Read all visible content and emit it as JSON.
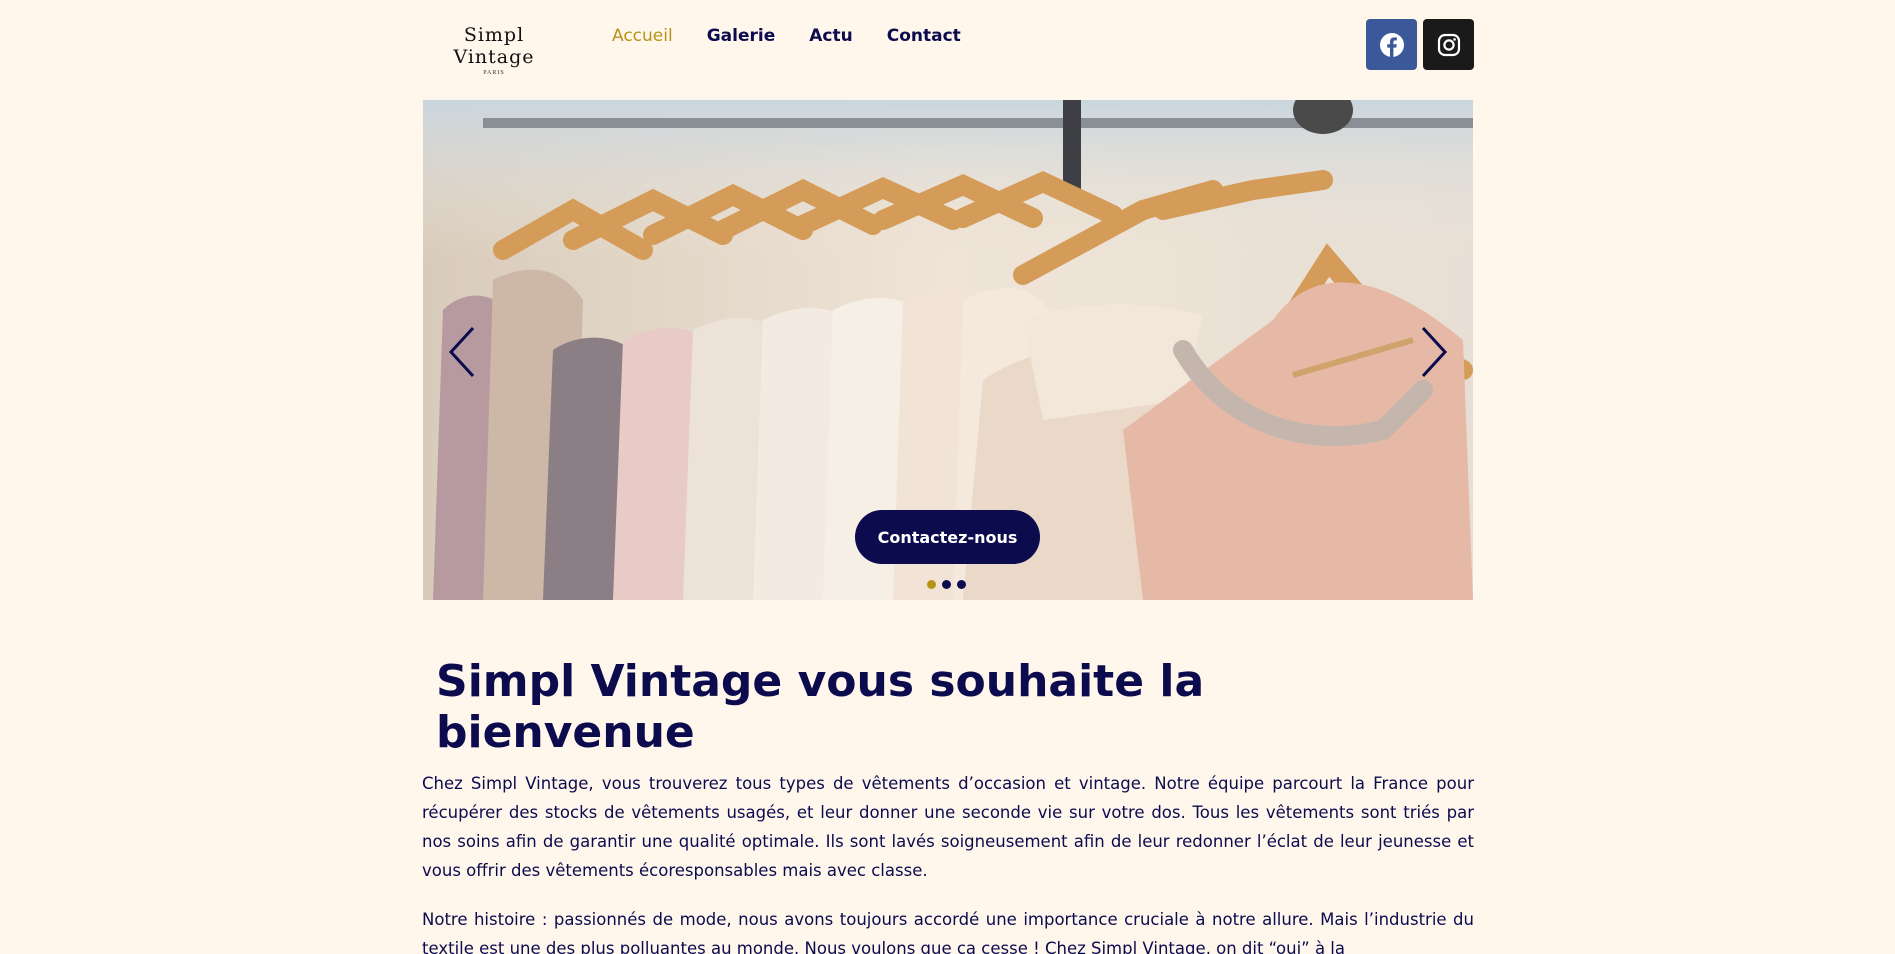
{
  "header": {
    "logo_main": "Simpl Vintage",
    "logo_sub": "PARIS",
    "nav": [
      {
        "label": "Accueil",
        "active": true
      },
      {
        "label": "Galerie",
        "active": false
      },
      {
        "label": "Actu",
        "active": false
      },
      {
        "label": "Contact",
        "active": false
      }
    ],
    "social": [
      {
        "icon": "facebook-icon",
        "color": "#3b5998"
      },
      {
        "icon": "instagram-icon",
        "color": "#1a1a1a"
      }
    ]
  },
  "hero": {
    "image": "clothes-on-hangers-photo",
    "cta_label": "Contactez-nous",
    "slide_count": 3,
    "active_slide": 1
  },
  "main": {
    "title": "Simpl Vintage vous souhaite la bienvenue",
    "paragraph1": "Chez Simpl Vintage, vous trouverez tous types de vêtements d’occasion et vintage. Notre équipe parcourt la France pour récupérer des stocks de vêtements usagés, et leur donner une seconde vie sur votre dos. Tous les vêtements sont triés par nos soins afin de garantir une qualité optimale. Ils sont lavés soigneusement afin de leur redonner l’éclat de leur jeunesse et vous offrir des vêtements écoresponsables mais avec classe.",
    "paragraph2": "Notre histoire : passionnés de mode, nous avons toujours accordé une importance cruciale à notre allure. Mais l’industrie du textile est une des plus polluantes au monde. Nous voulons que ça cesse ! Chez Simpl Vintage, on dit “oui” à la"
  },
  "colors": {
    "background": "#fff6ec",
    "navy": "#0b0b4e",
    "gold": "#b99318"
  }
}
